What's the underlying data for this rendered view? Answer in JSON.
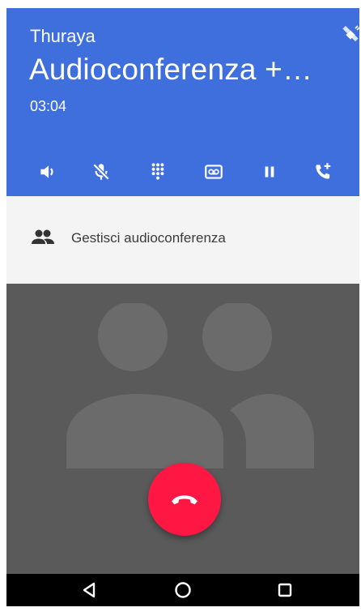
{
  "call": {
    "provider": "Thuraya",
    "title": "Audioconferenza +…",
    "timer": "03:04"
  },
  "controls": {
    "speaker": {
      "icon": "speaker-icon"
    },
    "mute": {
      "icon": "mic-off-icon"
    },
    "dialpad": {
      "icon": "dialpad-icon"
    },
    "voicemail": {
      "icon": "voicemail-icon"
    },
    "hold": {
      "icon": "pause-icon"
    },
    "add_call": {
      "icon": "add-call-icon"
    }
  },
  "conference": {
    "manage_label": "Gestisci audioconferenza",
    "icon": "people-icon"
  },
  "end_call": {
    "icon": "call-end-icon"
  },
  "navigation": {
    "back": "back-icon",
    "home": "home-icon",
    "recents": "recents-icon"
  },
  "colors": {
    "header": "#3f6fdc",
    "end_call": "#ff1744",
    "photo_background": "#5a5a5a",
    "manage_background": "#f4f4f4"
  }
}
